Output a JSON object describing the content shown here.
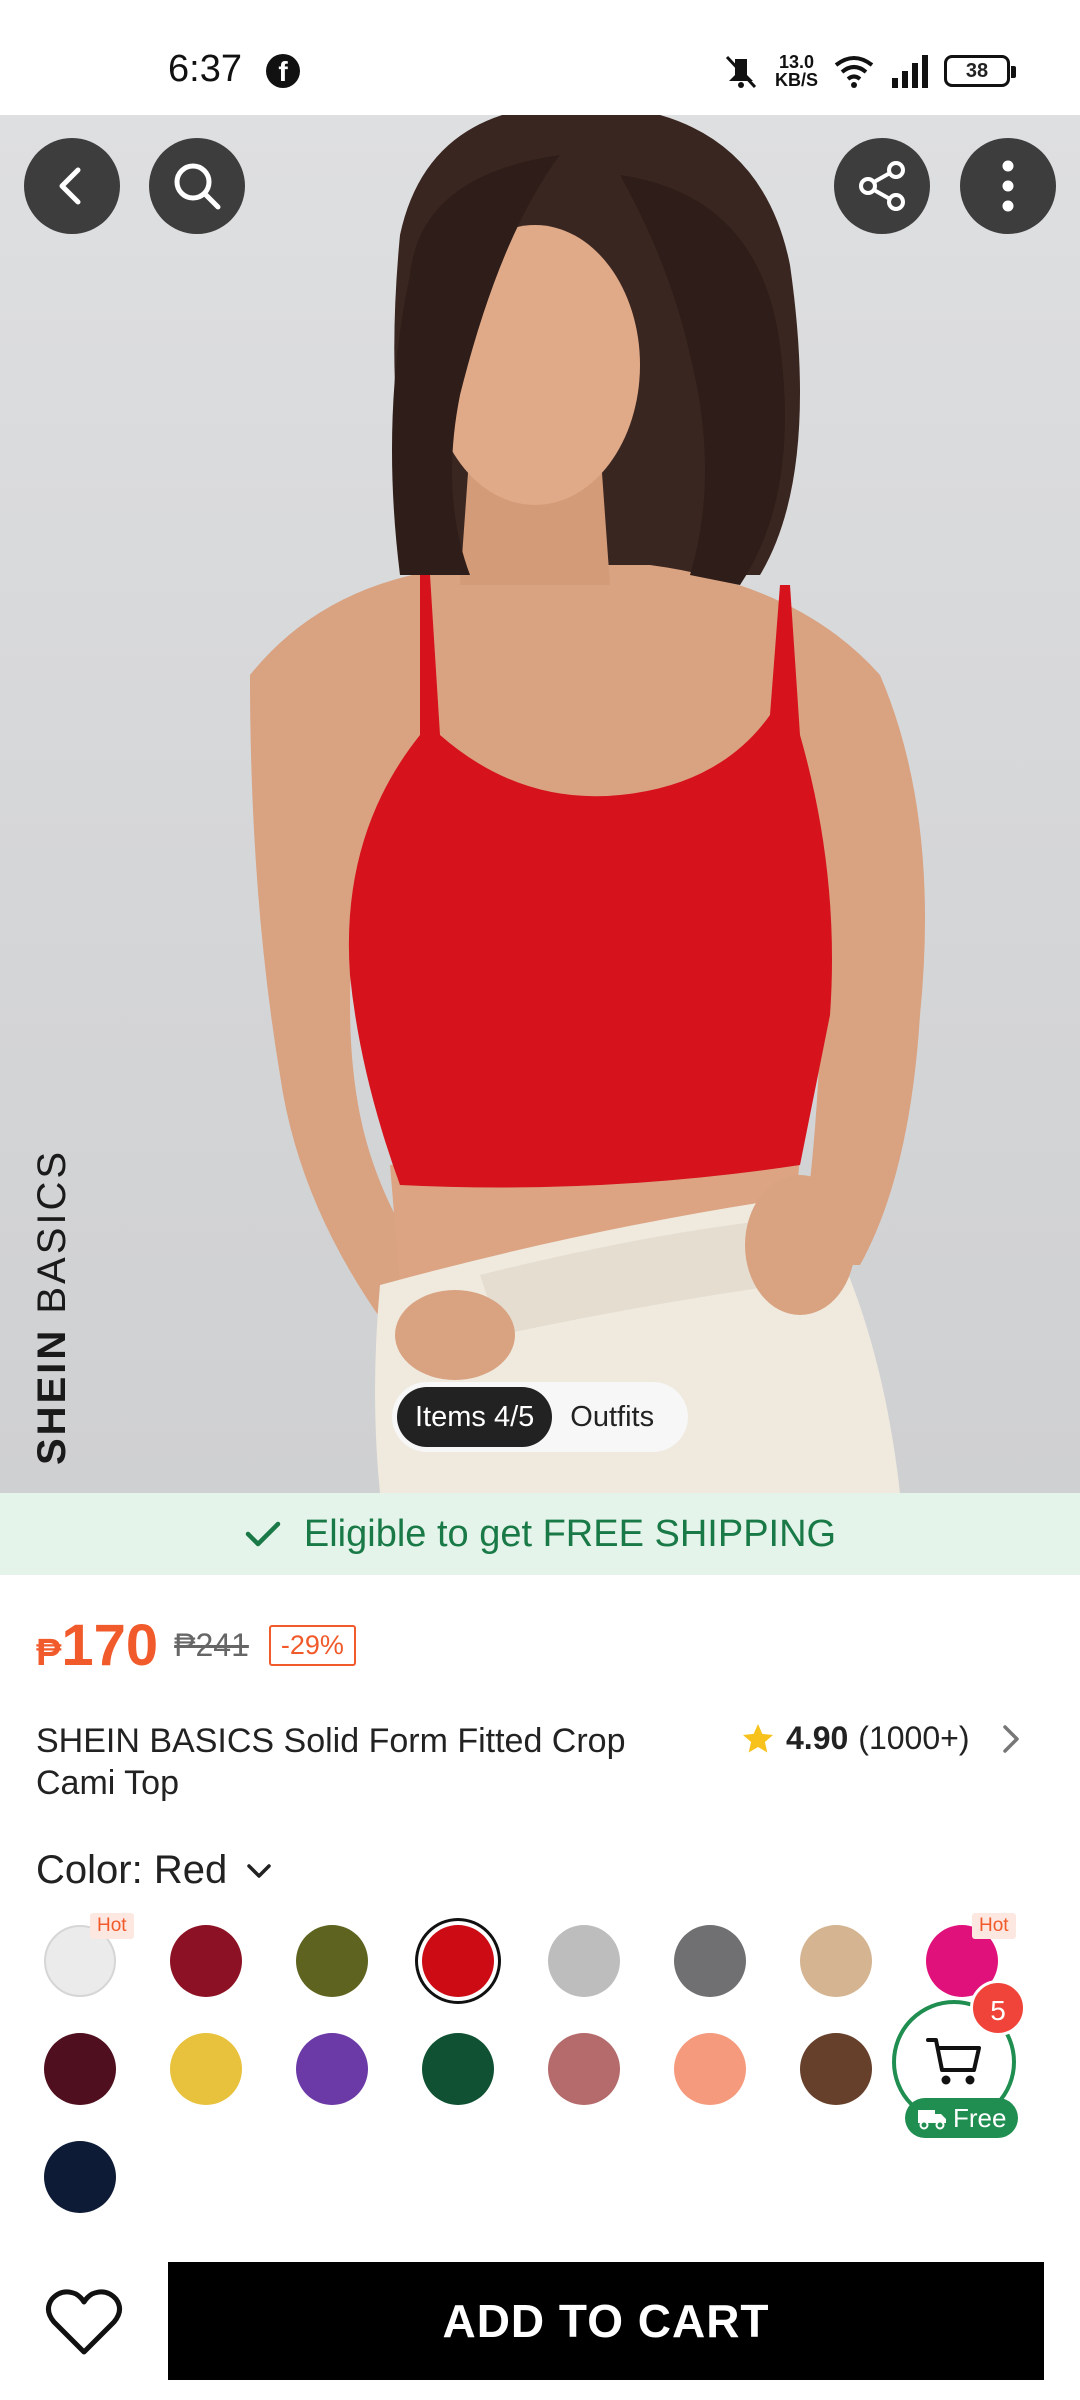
{
  "status_bar": {
    "time": "6:37",
    "net_speed_top": "13.0",
    "net_speed_bottom": "KB/S",
    "battery": "38"
  },
  "gallery": {
    "brand_bold": "SHEIN",
    "brand_light": " BASICS",
    "items_label": "Items 4/5",
    "outfits_label": "Outfits"
  },
  "shipping_banner": "Eligible to get FREE SHIPPING",
  "price": {
    "currency": "₱",
    "current": "170",
    "original": "₱241",
    "discount": "-29%"
  },
  "product": {
    "title": "SHEIN BASICS Solid Form Fitted Crop Cami Top"
  },
  "rating": {
    "score": "4.90",
    "count": "(1000+)"
  },
  "color": {
    "label": "Color: Red"
  },
  "swatches": [
    {
      "name": "white",
      "color": "#ebebeb",
      "hot": "Hot"
    },
    {
      "name": "burgundy",
      "color": "#8d1124"
    },
    {
      "name": "olive",
      "color": "#5e6420"
    },
    {
      "name": "red",
      "color": "#cc0b14",
      "selected": true
    },
    {
      "name": "light-grey",
      "color": "#bdbdbd"
    },
    {
      "name": "dark-grey",
      "color": "#707072"
    },
    {
      "name": "tan",
      "color": "#d4b491"
    },
    {
      "name": "fuchsia",
      "color": "#e0117a",
      "hot": "Hot"
    },
    {
      "name": "maroon",
      "color": "#4f0f1f"
    },
    {
      "name": "mustard",
      "color": "#e8c23c"
    },
    {
      "name": "purple",
      "color": "#6b3aa6"
    },
    {
      "name": "forest-green",
      "color": "#0f5132"
    },
    {
      "name": "rose-brown",
      "color": "#b56b6c"
    },
    {
      "name": "peach",
      "color": "#f59a7d"
    },
    {
      "name": "brown",
      "color": "#66402a"
    },
    {
      "name": "camel",
      "color": "#a9826b"
    },
    {
      "name": "navy",
      "color": "#0d1b36"
    }
  ],
  "cart": {
    "badge": "5",
    "free_label": "Free"
  },
  "add_to_cart_label": "ADD TO CART",
  "colors": {
    "accent": "#f15a2b",
    "free_green": "#1f8e50",
    "banner_bg": "#e5f4ea"
  }
}
